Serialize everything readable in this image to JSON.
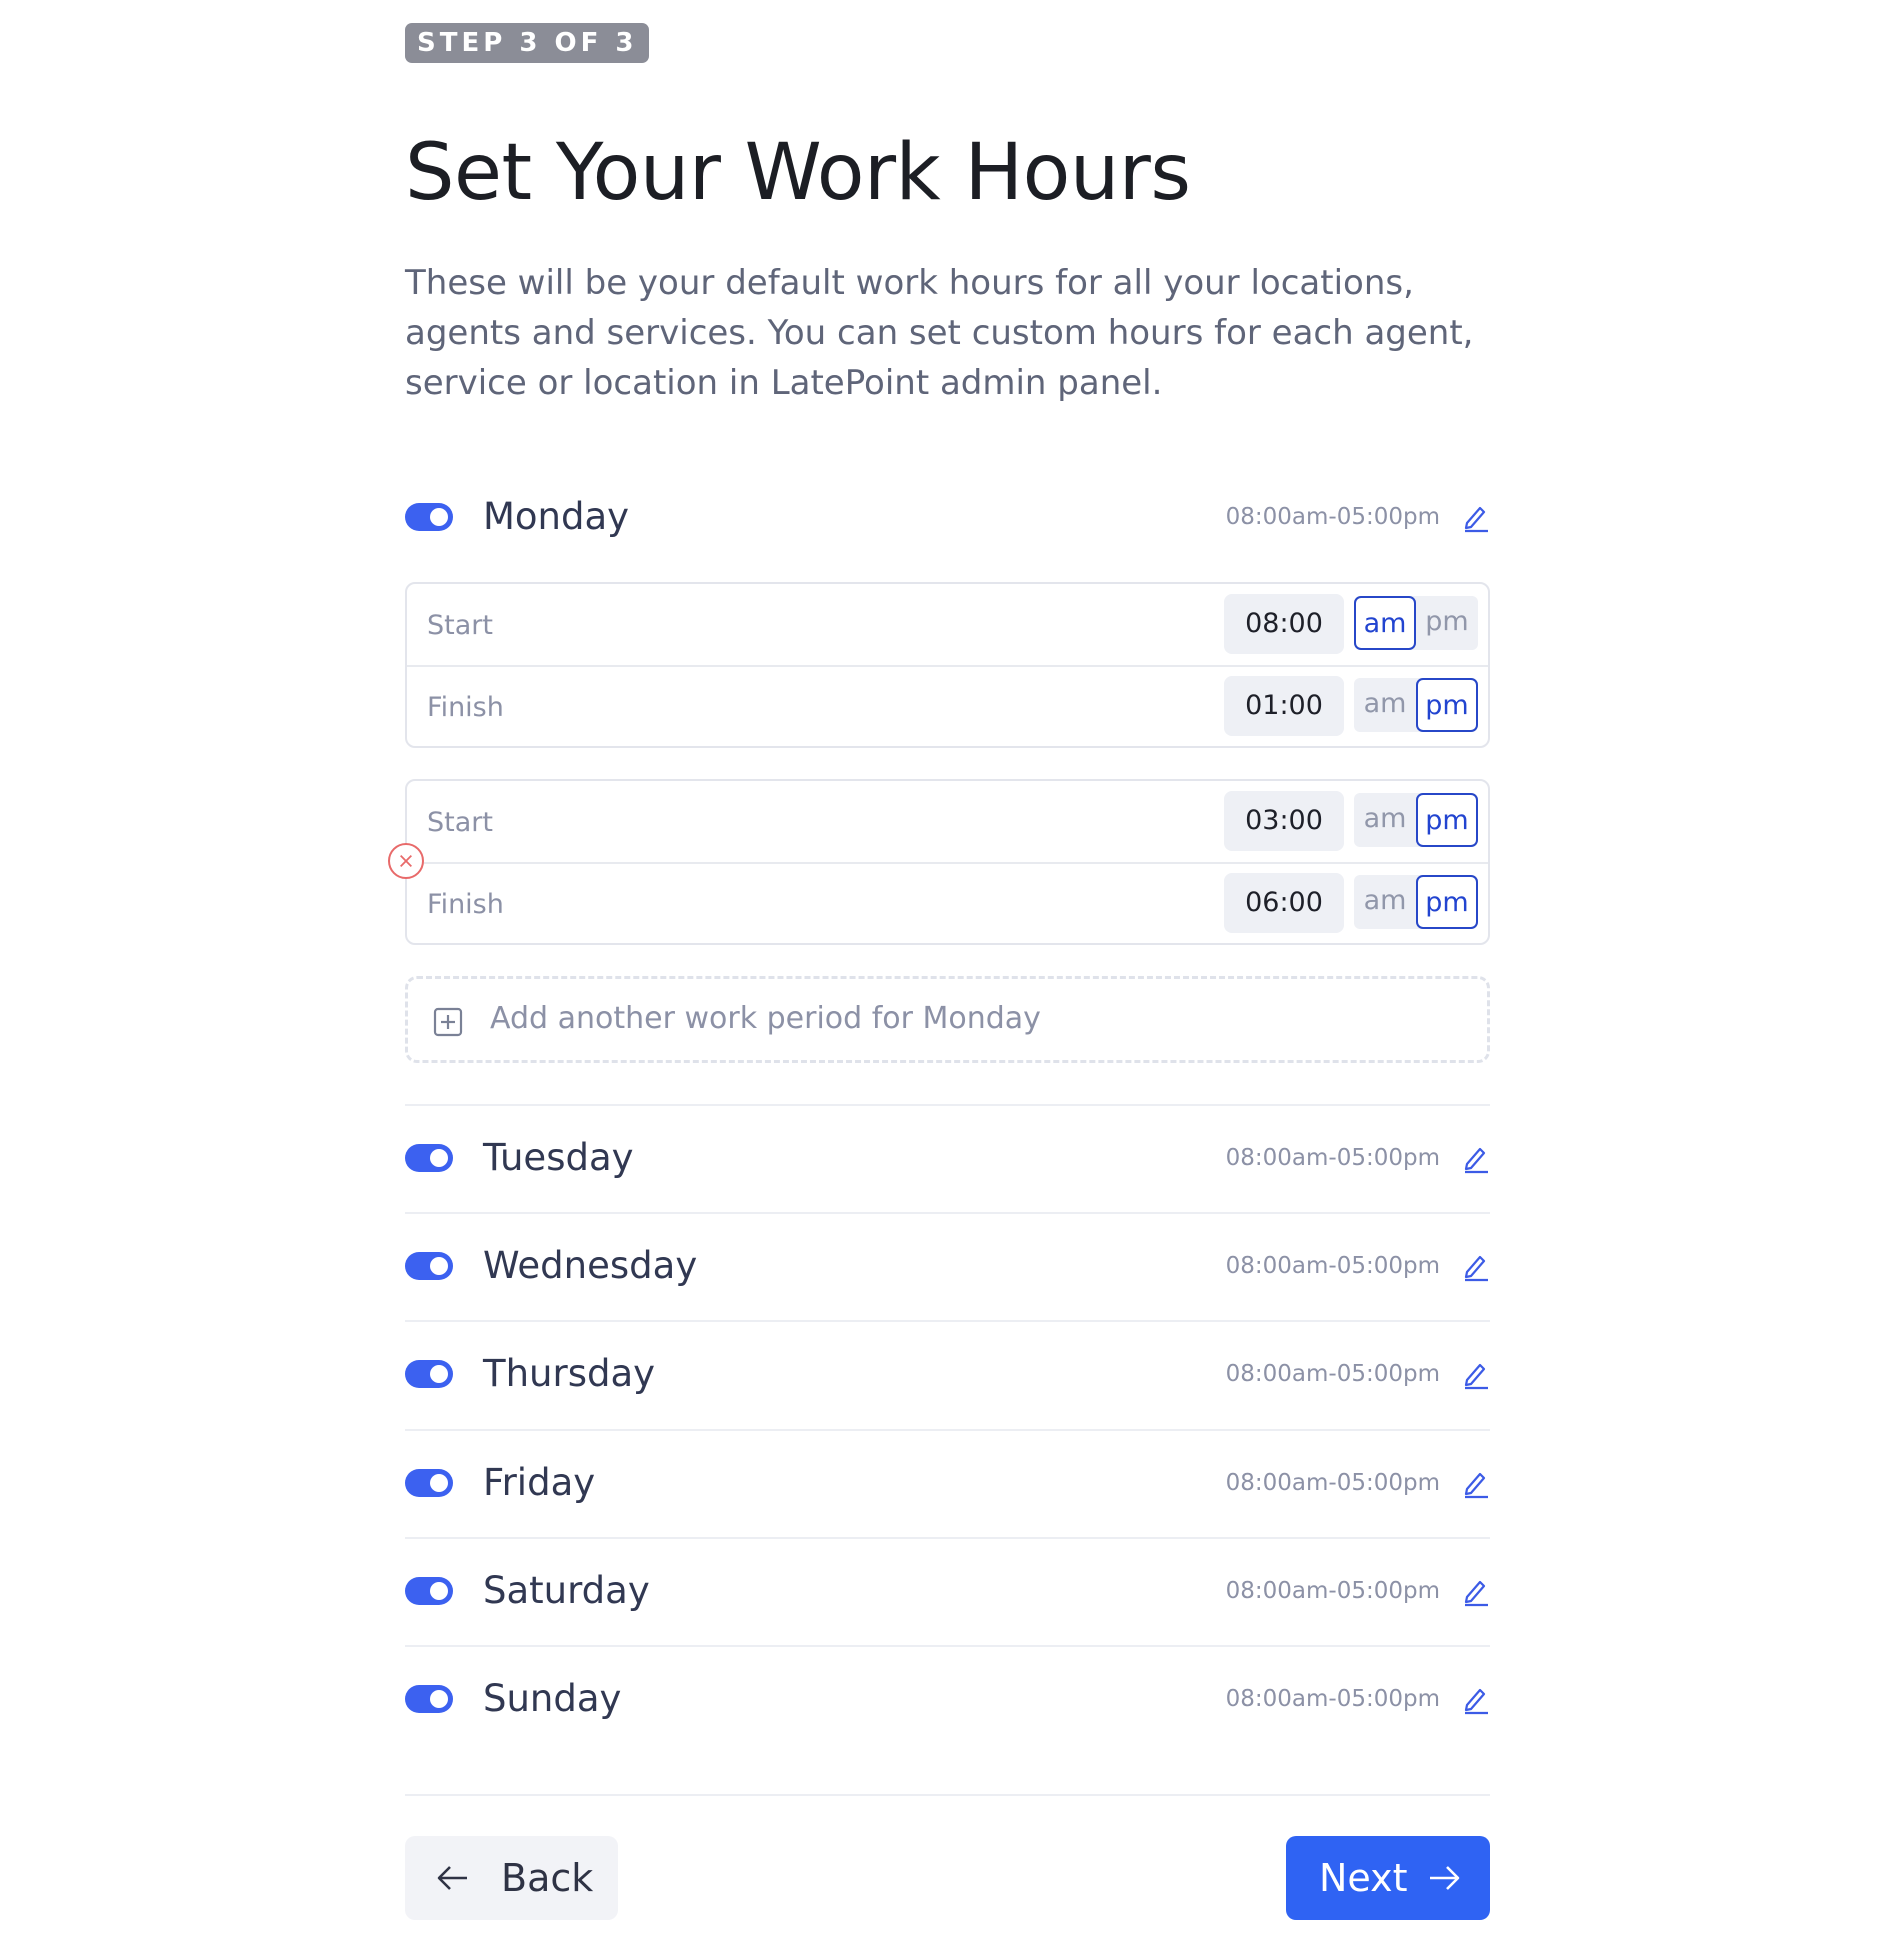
{
  "step_badge": "STEP 3 OF 3",
  "title": "Set Your Work Hours",
  "description": "These will be your default work hours for all your locations, agents and services. You can set custom hours for each agent, service or location in LatePoint admin panel.",
  "colors": {
    "accent": "#3c61f0",
    "primary_button": "#2f63f3",
    "remove": "#e86a6a"
  },
  "days": [
    {
      "name": "Monday",
      "hours": "08:00am-05:00pm",
      "enabled": true,
      "expanded": true
    },
    {
      "name": "Tuesday",
      "hours": "08:00am-05:00pm",
      "enabled": true
    },
    {
      "name": "Wednesday",
      "hours": "08:00am-05:00pm",
      "enabled": true
    },
    {
      "name": "Thursday",
      "hours": "08:00am-05:00pm",
      "enabled": true
    },
    {
      "name": "Friday",
      "hours": "08:00am-05:00pm",
      "enabled": true
    },
    {
      "name": "Saturday",
      "hours": "08:00am-05:00pm",
      "enabled": true
    },
    {
      "name": "Sunday",
      "hours": "08:00am-05:00pm",
      "enabled": true
    }
  ],
  "monday_periods": [
    {
      "start": {
        "label": "Start",
        "time": "08:00",
        "meridiem": "am"
      },
      "finish": {
        "label": "Finish",
        "time": "01:00",
        "meridiem": "pm"
      }
    },
    {
      "start": {
        "label": "Start",
        "time": "03:00",
        "meridiem": "pm"
      },
      "finish": {
        "label": "Finish",
        "time": "06:00",
        "meridiem": "pm"
      }
    }
  ],
  "ampm_labels": {
    "am": "am",
    "pm": "pm"
  },
  "add_period_label": "Add another work period for Monday",
  "buttons": {
    "back": "Back",
    "next": "Next"
  },
  "icons": {
    "edit": "pencil-icon",
    "remove": "close-circle-icon",
    "add": "plus-square-icon",
    "back": "arrow-left-icon",
    "next": "arrow-right-icon"
  }
}
